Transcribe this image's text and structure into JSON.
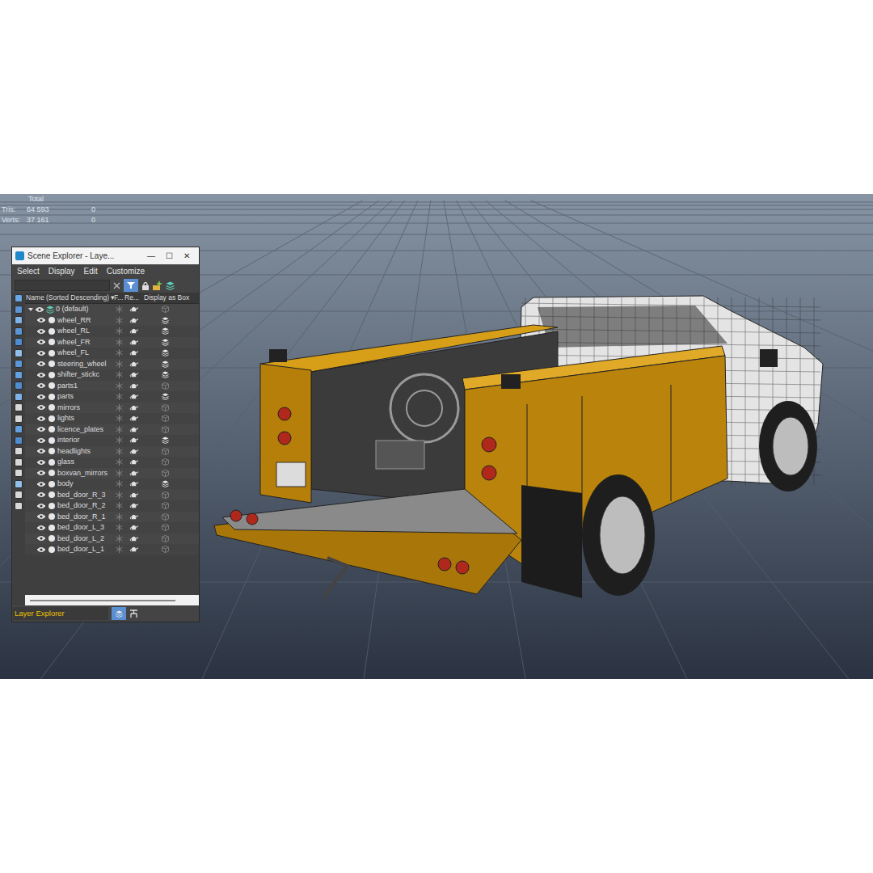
{
  "stats": {
    "header": "Total",
    "rows": [
      {
        "label": "Tris:",
        "value": "64 593",
        "selected_value": "0"
      },
      {
        "label": "Verts:",
        "value": "37 161",
        "selected_value": "0"
      }
    ]
  },
  "window": {
    "title": "Scene Explorer - Laye...",
    "controls": [
      "—",
      "☐",
      "✕"
    ],
    "menu": [
      "Select",
      "Display",
      "Edit",
      "Customize"
    ],
    "columns": [
      "Name (Sorted Descending)",
      "F...",
      "Re...",
      "Display as Box"
    ],
    "sort_indicator": "▾",
    "root": {
      "name": "0 (default)",
      "expanded": true,
      "visible": true
    },
    "layers": [
      {
        "name": "wheel_RR",
        "visible": true,
        "box_icon": "layers"
      },
      {
        "name": "wheel_RL",
        "visible": true,
        "box_icon": "layers"
      },
      {
        "name": "wheel_FR",
        "visible": true,
        "box_icon": "layers"
      },
      {
        "name": "wheel_FL",
        "visible": true,
        "box_icon": "layers"
      },
      {
        "name": "steering_wheel",
        "visible": true,
        "box_icon": "layers"
      },
      {
        "name": "shifter_stickc",
        "visible": true,
        "box_icon": "layers"
      },
      {
        "name": "parts1",
        "visible": true,
        "box_icon": "cube"
      },
      {
        "name": "parts",
        "visible": true,
        "box_icon": "layers"
      },
      {
        "name": "mirrors",
        "visible": true,
        "box_icon": "cube"
      },
      {
        "name": "lights",
        "visible": true,
        "box_icon": "cube"
      },
      {
        "name": "licence_plates",
        "visible": true,
        "box_icon": "cube"
      },
      {
        "name": "interior",
        "visible": true,
        "box_icon": "layers"
      },
      {
        "name": "headlights",
        "visible": true,
        "box_icon": "cube"
      },
      {
        "name": "glass",
        "visible": true,
        "box_icon": "cube"
      },
      {
        "name": "boxvan_mirrors",
        "visible": true,
        "box_icon": "cube"
      },
      {
        "name": "body",
        "visible": true,
        "box_icon": "layers"
      },
      {
        "name": "bed_door_R_3",
        "visible": true,
        "box_icon": "cube"
      },
      {
        "name": "bed_door_R_2",
        "visible": true,
        "box_icon": "cube"
      },
      {
        "name": "bed_door_R_1",
        "visible": true,
        "box_icon": "cube"
      },
      {
        "name": "bed_door_L_3",
        "visible": true,
        "box_icon": "cube"
      },
      {
        "name": "bed_door_L_2",
        "visible": true,
        "box_icon": "cube"
      },
      {
        "name": "bed_door_L_1",
        "visible": true,
        "box_icon": "cube"
      }
    ],
    "footer": {
      "label": "Layer Explorer"
    }
  }
}
